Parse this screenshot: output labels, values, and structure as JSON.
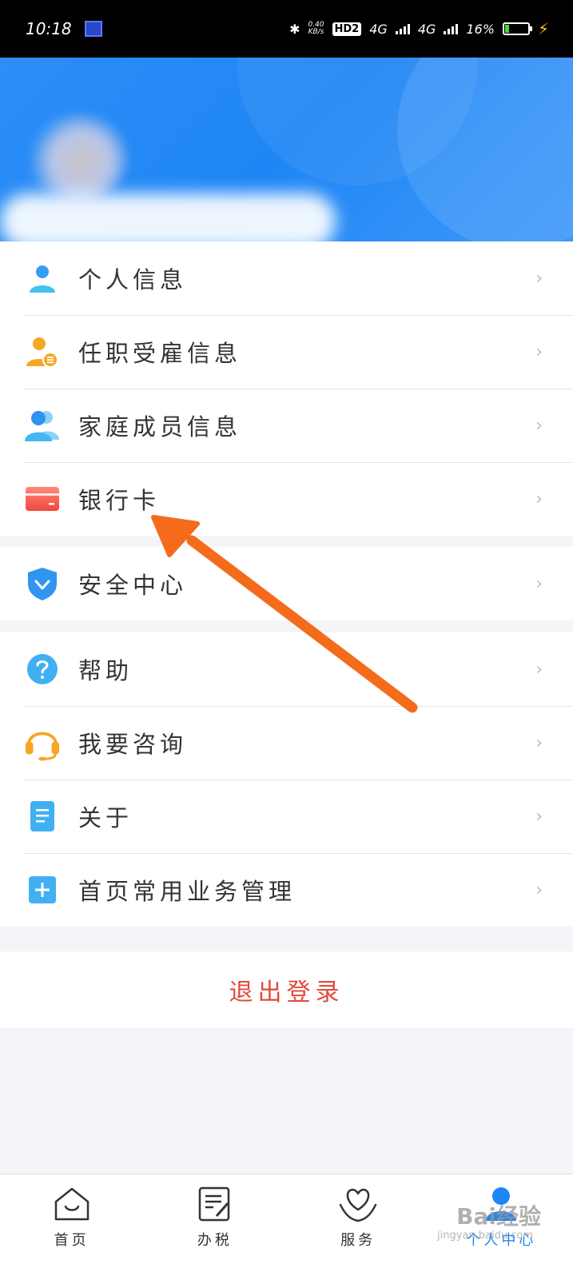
{
  "status_bar": {
    "time": "10:18",
    "net_speed_top": "0.40",
    "net_speed_bottom": "KB/s",
    "hd": "HD2",
    "sig1": "4G",
    "sig2": "4G",
    "battery": "16%"
  },
  "menu": {
    "group1": [
      {
        "label": "个人信息",
        "icon": "person-icon"
      },
      {
        "label": "任职受雇信息",
        "icon": "employment-icon"
      },
      {
        "label": "家庭成员信息",
        "icon": "family-icon"
      },
      {
        "label": "银行卡",
        "icon": "bank-card-icon"
      }
    ],
    "group2": [
      {
        "label": "安全中心",
        "icon": "shield-icon"
      }
    ],
    "group3": [
      {
        "label": "帮助",
        "icon": "help-icon"
      },
      {
        "label": "我要咨询",
        "icon": "headset-icon"
      },
      {
        "label": "关于",
        "icon": "document-icon"
      },
      {
        "label": "首页常用业务管理",
        "icon": "plus-icon"
      }
    ]
  },
  "logout_label": "退出登录",
  "bottom_nav": [
    {
      "label": "首页",
      "icon": "home-icon"
    },
    {
      "label": "办税",
      "icon": "tax-icon"
    },
    {
      "label": "服务",
      "icon": "service-heart-icon"
    },
    {
      "label": "个人中心",
      "icon": "personal-center-icon",
      "active": true
    }
  ],
  "watermark": {
    "main": "Bai经验",
    "sub": "jingyan.baidu.com"
  },
  "colors": {
    "primary": "#1f86f5",
    "logout": "#e24a3b",
    "arrow": "#f46b1c"
  }
}
